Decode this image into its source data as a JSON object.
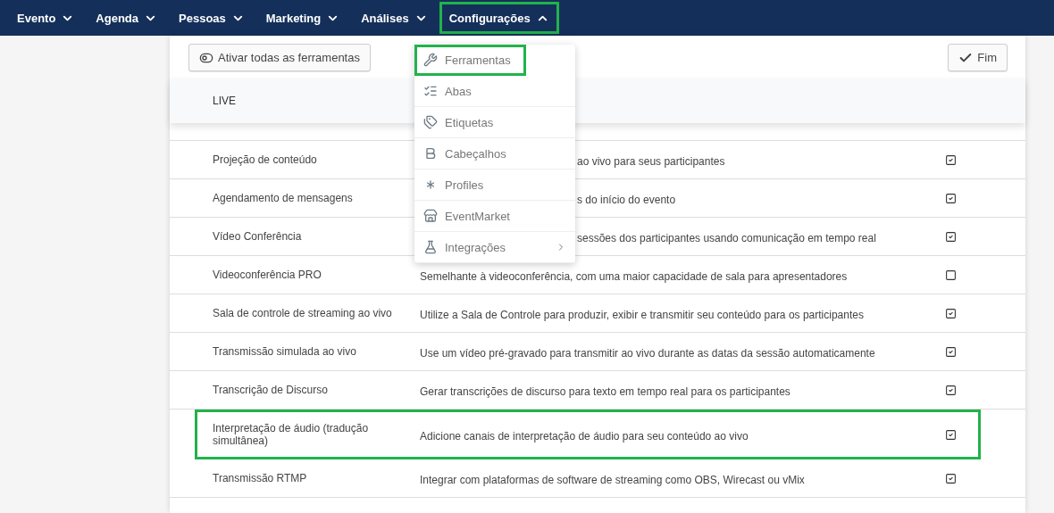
{
  "nav": [
    {
      "label": "Evento",
      "expanded": false,
      "highlighted": false
    },
    {
      "label": "Agenda",
      "expanded": false,
      "highlighted": false
    },
    {
      "label": "Pessoas",
      "expanded": false,
      "highlighted": false
    },
    {
      "label": "Marketing",
      "expanded": false,
      "highlighted": false
    },
    {
      "label": "Análises",
      "expanded": false,
      "highlighted": false
    },
    {
      "label": "Configurações",
      "expanded": true,
      "highlighted": true
    }
  ],
  "toolbar": {
    "toggle_all": "Ativar todas as ferramentas",
    "done": "Fim"
  },
  "table": {
    "section": "LIVE",
    "rows": [
      {
        "name": "Projeção de conteúdo",
        "description": "ao vivo para seus participantes",
        "partly_hidden": true,
        "checked": true,
        "highlighted": false
      },
      {
        "name": "Agendamento de mensagens",
        "description": "s do início do evento",
        "partly_hidden": true,
        "checked": true,
        "highlighted": false
      },
      {
        "name": "Vídeo Conferência",
        "description": "sessões dos participantes usando comunicação em tempo real",
        "partly_hidden": true,
        "checked": true,
        "highlighted": false
      },
      {
        "name": "Videoconferência PRO",
        "description": "Semelhante à videoconferência, com uma maior capacidade de sala para apresentadores",
        "checked": false,
        "highlighted": false
      },
      {
        "name": "Sala de controle de streaming ao vivo",
        "description": "Utilize a Sala de Controle para produzir, exibir e transmitir seu conteúdo para os participantes",
        "checked": true,
        "highlighted": false
      },
      {
        "name": "Transmissão simulada ao vivo",
        "description": "Use um vídeo pré-gravado para transmitir ao vivo durante as datas da sessão automaticamente",
        "checked": true,
        "highlighted": false
      },
      {
        "name": "Transcrição de Discurso",
        "description": "Gerar transcrições de discurso para texto em tempo real para os participantes",
        "checked": true,
        "highlighted": false
      },
      {
        "name": "Interpretação de áudio (tradução simultânea)",
        "description": "Adicione canais de interpretação de áudio para seu conteúdo ao vivo",
        "checked": true,
        "highlighted": true
      },
      {
        "name": "Transmissão RTMP",
        "description": "Integrar com plataformas de software de streaming como OBS, Wirecast ou vMix",
        "checked": true,
        "highlighted": false
      }
    ]
  },
  "menu": [
    {
      "label": "Ferramentas",
      "kind": "wrench",
      "highlighted": true,
      "submenu": false
    },
    {
      "label": "Abas",
      "kind": "list",
      "highlighted": false,
      "submenu": false
    },
    {
      "label": "Etiquetas",
      "kind": "tags",
      "highlighted": false,
      "submenu": false
    },
    {
      "label": "Cabeçalhos",
      "kind": "bold",
      "highlighted": false,
      "submenu": false
    },
    {
      "label": "Profiles",
      "kind": "asterisk",
      "highlighted": false,
      "submenu": false
    },
    {
      "label": "EventMarket",
      "kind": "store",
      "highlighted": false,
      "submenu": false
    },
    {
      "label": "Integrações",
      "kind": "flask",
      "highlighted": false,
      "submenu": true
    }
  ]
}
